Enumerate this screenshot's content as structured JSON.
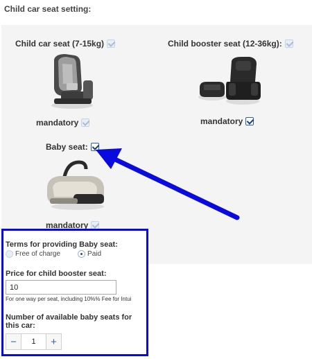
{
  "page": {
    "title": "Child car seat setting:"
  },
  "seats": {
    "child": {
      "label": "Child car seat (7-15kg)",
      "mandatory_label": "mandatory",
      "checked": false,
      "mandatory_checked": false
    },
    "booster": {
      "label": "Child booster seat (12-36kg):",
      "mandatory_label": "mandatory",
      "checked": false,
      "mandatory_checked": true
    },
    "baby": {
      "label": "Baby seat:",
      "mandatory_label": "mandatory",
      "checked": true,
      "mandatory_checked": false
    }
  },
  "terms": {
    "title": "Terms for providing Baby seat:",
    "options": [
      {
        "label": "Free of charge",
        "selected": false
      },
      {
        "label": "Paid",
        "selected": true
      }
    ]
  },
  "price": {
    "label": "Price for child booster seat:",
    "value": "10",
    "hint": "For one way per seat, including 10%% Fee for Intui"
  },
  "available": {
    "label": "Number of available baby seats for this car:",
    "value": "1",
    "minus": "−",
    "plus": "+"
  },
  "colors": {
    "highlight_box": "#0a0adf",
    "arrow": "#0a0adf",
    "panel": "#f4f4f4"
  }
}
